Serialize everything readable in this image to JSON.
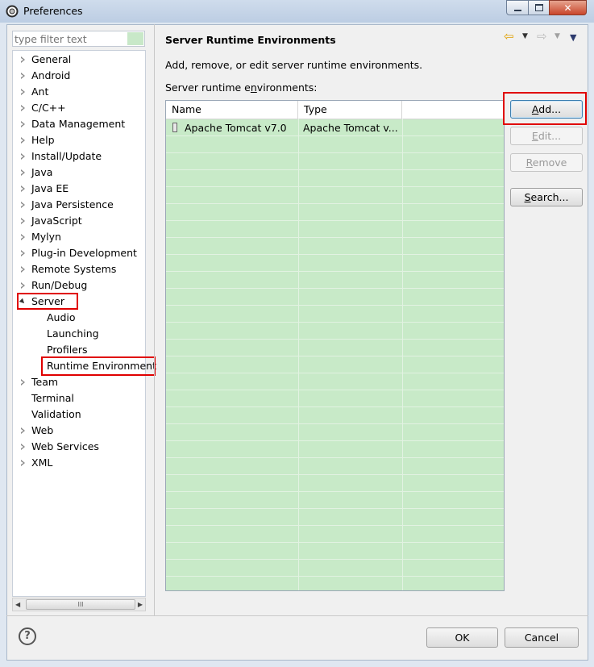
{
  "window": {
    "title": "Preferences",
    "icon": "gear-icon"
  },
  "filter": {
    "placeholder": "type filter text"
  },
  "tree": [
    {
      "label": "General",
      "state": "collapsed"
    },
    {
      "label": "Android",
      "state": "collapsed"
    },
    {
      "label": "Ant",
      "state": "collapsed"
    },
    {
      "label": "C/C++",
      "state": "collapsed"
    },
    {
      "label": "Data Management",
      "state": "collapsed"
    },
    {
      "label": "Help",
      "state": "collapsed"
    },
    {
      "label": "Install/Update",
      "state": "collapsed"
    },
    {
      "label": "Java",
      "state": "collapsed"
    },
    {
      "label": "Java EE",
      "state": "collapsed"
    },
    {
      "label": "Java Persistence",
      "state": "collapsed"
    },
    {
      "label": "JavaScript",
      "state": "collapsed"
    },
    {
      "label": "Mylyn",
      "state": "collapsed"
    },
    {
      "label": "Plug-in Development",
      "state": "collapsed"
    },
    {
      "label": "Remote Systems",
      "state": "collapsed"
    },
    {
      "label": "Run/Debug",
      "state": "collapsed"
    },
    {
      "label": "Server",
      "state": "expanded",
      "highlighted": true
    },
    {
      "label": "Audio",
      "state": "child"
    },
    {
      "label": "Launching",
      "state": "child"
    },
    {
      "label": "Profilers",
      "state": "child"
    },
    {
      "label": "Runtime Environment",
      "state": "child",
      "highlighted": true,
      "selected": true
    },
    {
      "label": "Team",
      "state": "collapsed"
    },
    {
      "label": "Terminal",
      "state": "leaf"
    },
    {
      "label": "Validation",
      "state": "leaf"
    },
    {
      "label": "Web",
      "state": "collapsed"
    },
    {
      "label": "Web Services",
      "state": "collapsed"
    },
    {
      "label": "XML",
      "state": "collapsed"
    }
  ],
  "scrollbar": {
    "thumb_label": "III"
  },
  "page": {
    "title": "Server Runtime Environments",
    "description": "Add, remove, or edit server runtime environments.",
    "list_label_pre": "Server runtime e",
    "list_label_mnemonic": "n",
    "list_label_post": "vironments:"
  },
  "table": {
    "columns": [
      "Name",
      "Type"
    ],
    "rows": [
      {
        "name": "Apache Tomcat v7.0",
        "type": "Apache Tomcat v..."
      }
    ]
  },
  "buttons": {
    "add": {
      "mnemonic": "A",
      "rest": "dd...",
      "enabled": true,
      "highlighted": true
    },
    "edit": {
      "mnemonic": "E",
      "rest": "dit...",
      "enabled": false
    },
    "remove": {
      "mnemonic": "R",
      "rest": "emove",
      "enabled": false
    },
    "search": {
      "mnemonic": "S",
      "rest": "earch...",
      "enabled": true
    },
    "ok": "OK",
    "cancel": "Cancel"
  },
  "help": {
    "symbol": "?"
  },
  "colors": {
    "highlight": "#e00000",
    "table_fill": "#c8eac8"
  }
}
